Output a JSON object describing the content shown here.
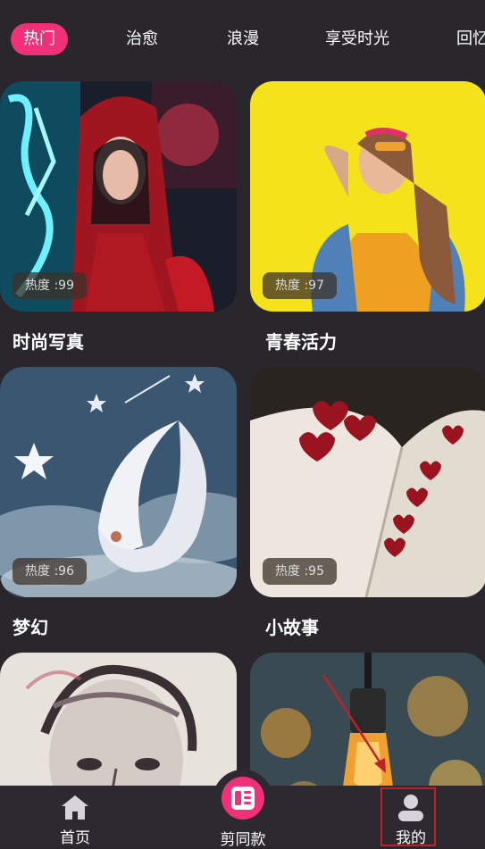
{
  "tabs": [
    {
      "label": "热门",
      "active": true
    },
    {
      "label": "治愈",
      "active": false
    },
    {
      "label": "浪漫",
      "active": false
    },
    {
      "label": "享受时光",
      "active": false
    },
    {
      "label": "回忆",
      "active": false
    }
  ],
  "cards": [
    {
      "title": "时尚写真",
      "heat": "热度 :99"
    },
    {
      "title": "青春活力",
      "heat": "热度 :97"
    },
    {
      "title": "梦幻",
      "heat": "热度 :96"
    },
    {
      "title": "小故事",
      "heat": "热度 :95"
    }
  ],
  "nav": {
    "home_label": "首页",
    "same_label": "剪同款",
    "mine_label": "我的"
  },
  "colors": {
    "accent": "#f0317a",
    "background": "#29262c",
    "highlight": "#c0202a"
  }
}
